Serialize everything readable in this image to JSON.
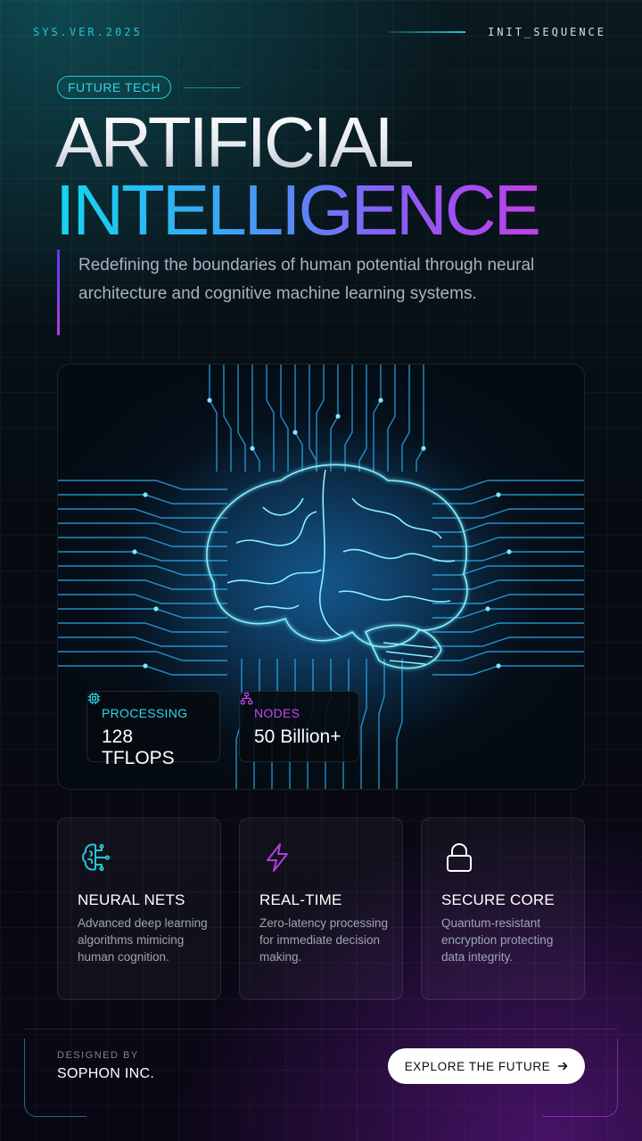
{
  "header": {
    "version_label": "SYS.VER.2025",
    "sequence_label": "INIT_SEQUENCE"
  },
  "hero": {
    "tag": "FUTURE TECH",
    "title_line1": "ARTIFICIAL",
    "title_line2": "INTELLIGENCE",
    "description": "Redefining the boundaries of human potential through neural architecture and cognitive machine learning systems."
  },
  "stats": [
    {
      "label": "PROCESSING",
      "value": "128 TFLOPS",
      "icon": "chip-icon",
      "color": "#2fd6e4"
    },
    {
      "label": "NODES",
      "value": "50 Billion+",
      "icon": "network-icon",
      "color": "#c447ee"
    }
  ],
  "features": [
    {
      "title": "NEURAL NETS",
      "description": "Advanced deep learning algorithms mimicing human cognition.",
      "icon": "brain-circuit-icon",
      "color": "#22c7d6"
    },
    {
      "title": "REAL-TIME",
      "description": "Zero-latency processing for immediate decision making.",
      "icon": "lightning-icon",
      "color": "#b43be4"
    },
    {
      "title": "SECURE CORE",
      "description": "Quantum-resistant encryption protecting data integrity.",
      "icon": "lock-icon",
      "color": "#ffffff"
    }
  ],
  "footer": {
    "designed_by_label": "DESIGNED BY",
    "company": "SOPHON INC.",
    "cta_label": "EXPLORE THE FUTURE",
    "cta_icon": "arrow-right-icon"
  },
  "colors": {
    "accent_cyan": "#22c7d6",
    "accent_purple": "#b43be4",
    "background": "#060b12"
  }
}
